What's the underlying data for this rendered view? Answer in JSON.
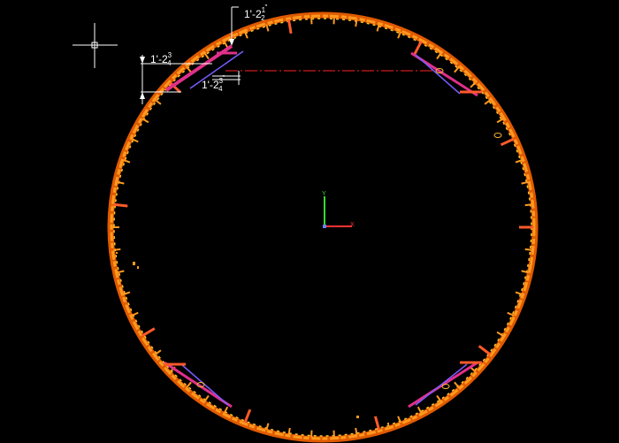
{
  "viewport": {
    "background": "#000000",
    "crosshair_icon": "crosshair-cursor-icon",
    "ucs_icon": "ucs-axis-icon"
  },
  "dimensions": [
    {
      "id": "dim-top",
      "text": "1'-2",
      "frac_num": "1",
      "frac_den": "2",
      "suffix": "\""
    },
    {
      "id": "dim-left-outer",
      "text": "1'-2",
      "frac_num": "3",
      "frac_den": "4",
      "suffix": ""
    },
    {
      "id": "dim-left-inner",
      "text": "1'-2",
      "frac_num": "3",
      "frac_den": "4",
      "suffix": "\""
    }
  ],
  "colors": {
    "ring_main": "#ff8c1a",
    "ring_hot": "#ffb833",
    "ring_dark": "#e05a00",
    "rib": "#ff6a1a",
    "magenta": "#e0308a",
    "purple": "#7a5cff",
    "axis_x": "#ff3333",
    "axis_y": "#33dd33",
    "axis_z": "#6680ff",
    "dim_line": "#ffffff",
    "ref_line": "#ff2222"
  }
}
